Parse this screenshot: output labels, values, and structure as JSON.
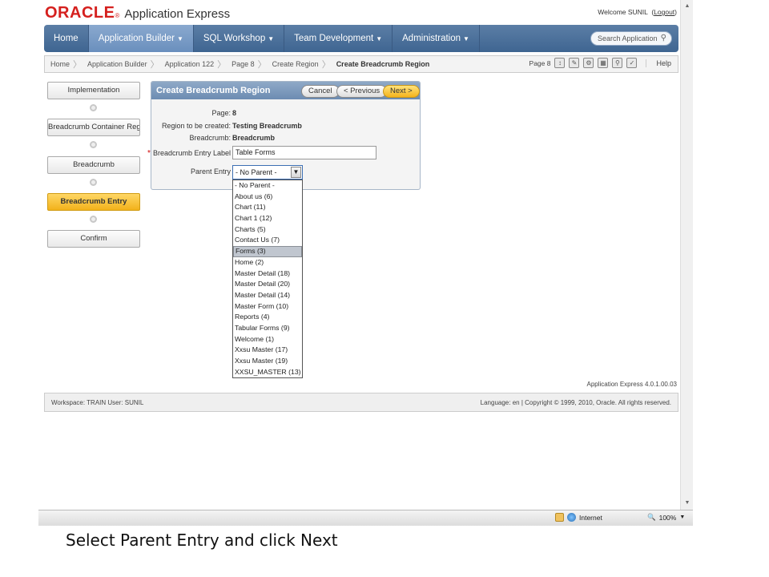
{
  "header": {
    "brand": "ORACLE",
    "brand_mark": "®",
    "product": "Application Express",
    "welcome": "Welcome SUNIL",
    "logout": "Logout"
  },
  "topnav": {
    "tabs": [
      {
        "label": "Home",
        "caret": ""
      },
      {
        "label": "Application Builder",
        "caret": "▼"
      },
      {
        "label": "SQL Workshop",
        "caret": "▼"
      },
      {
        "label": "Team Development",
        "caret": "▼"
      },
      {
        "label": "Administration",
        "caret": "▼"
      }
    ],
    "search_placeholder": "Search Application"
  },
  "breadcrumb": {
    "items": [
      "Home",
      "Application Builder",
      "Application 122",
      "Page 8",
      "Create Region",
      "Create Breadcrumb Region"
    ],
    "page_label": "Page 8",
    "help": "Help"
  },
  "wizard": {
    "steps": [
      "Implementation",
      "Breadcrumb Container Region",
      "Breadcrumb",
      "Breadcrumb Entry",
      "Confirm"
    ],
    "current_index": 3
  },
  "region": {
    "title": "Create Breadcrumb Region",
    "cancel": "Cancel",
    "previous": "< Previous",
    "next": "Next >",
    "fields": {
      "page_label": "Page:",
      "page_value": "8",
      "region_label": "Region to be created:",
      "region_value": "Testing Breadcrumb",
      "breadcrumb_label": "Breadcrumb:",
      "breadcrumb_value": "Breadcrumb",
      "entry_label_label": "Breadcrumb Entry Label",
      "entry_label_value": "Table Forms",
      "parent_entry_label": "Parent Entry",
      "parent_entry_value": "- No Parent -"
    },
    "parent_options": [
      "- No Parent -",
      "About us (6)",
      "Chart (11)",
      "Chart 1 (12)",
      "Charts (5)",
      "Contact Us (7)",
      "Forms (3)",
      "Home (2)",
      "Master Detail (18)",
      "Master Detail (20)",
      "Master Detail (14)",
      "Master Form (10)",
      "Reports (4)",
      "Tabular Forms (9)",
      "Welcome (1)",
      "Xxsu Master (17)",
      "Xxsu Master (19)",
      "XXSU_MASTER (13)"
    ],
    "highlighted_option": "Forms (3)"
  },
  "footer": {
    "version": "Application Express 4.0.1.00.03",
    "workspace": "Workspace: TRAIN User: SUNIL",
    "copyright": "Language: en | Copyright © 1999, 2010, Oracle. All rights reserved."
  },
  "statusbar": {
    "zone": "Internet",
    "zoom": "100%"
  },
  "caption": "Select Parent Entry and click Next",
  "colors": {
    "oracle_red": "#d5201e",
    "nav_blue": "#3f6591",
    "current_step": "#f2b21b"
  }
}
